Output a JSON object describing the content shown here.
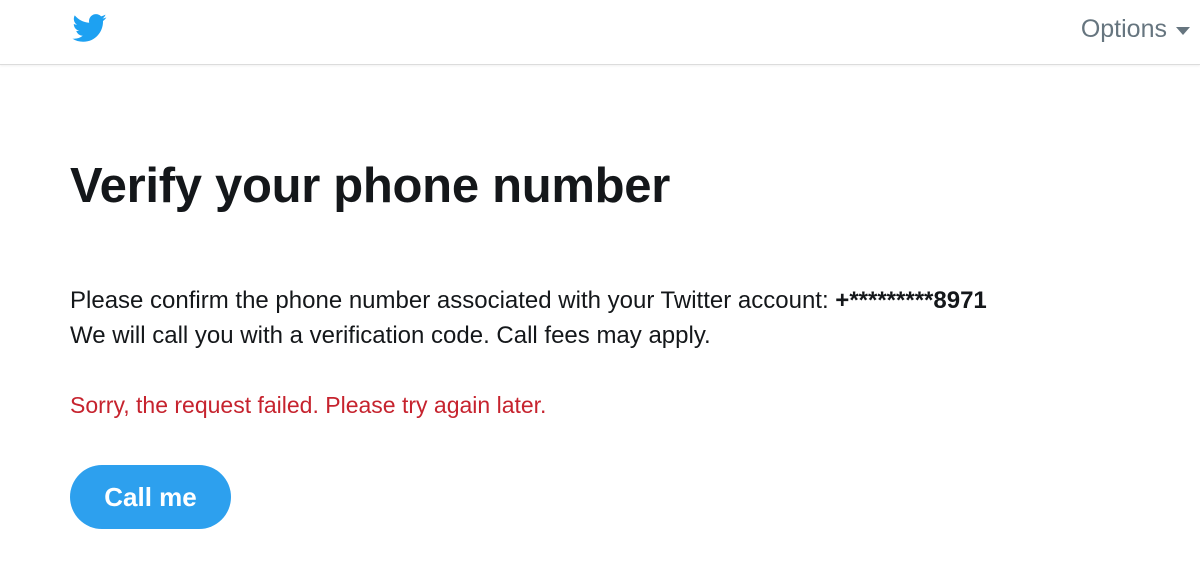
{
  "header": {
    "options_label": "Options",
    "brand_color": "#1DA1F2",
    "logo_icon": "twitter-bird-icon"
  },
  "main": {
    "title": "Verify your phone number",
    "confirm_text": "Please confirm the phone number associated with your Twitter account: ",
    "phone_masked": "+*********8971",
    "call_info": "We will call you with a verification code. Call fees may apply.",
    "error_message": "Sorry, the request failed. Please try again later.",
    "error_color": "#C6232E",
    "call_button_label": "Call me"
  }
}
